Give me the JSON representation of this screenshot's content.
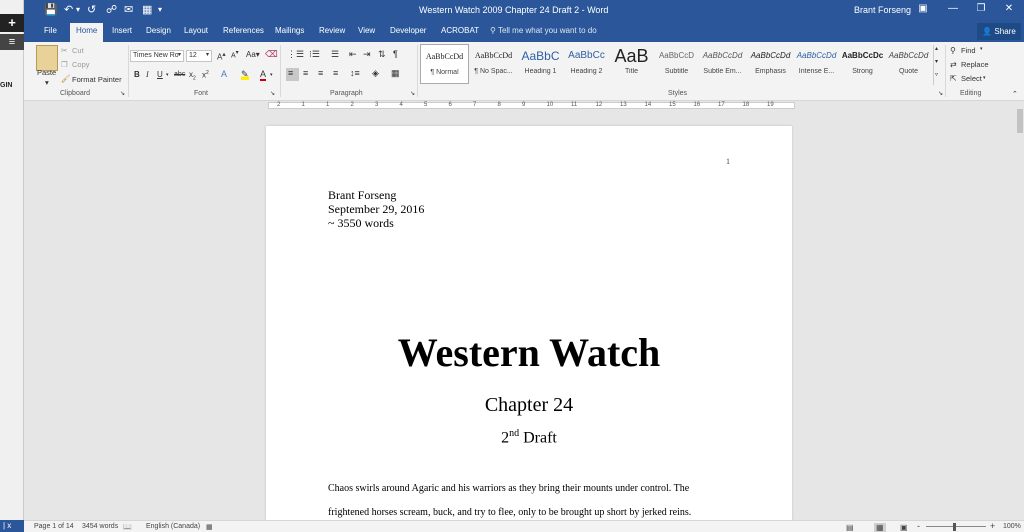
{
  "left_panel": {
    "plus": "+",
    "menu": "≡",
    "login_text": "GIN",
    "bottom_text": "| x"
  },
  "window": {
    "title": "Western Watch 2009 Chapter 24 Draft 2 - Word",
    "user": "Brant Forseng",
    "icons": [
      "save-icon",
      "undo-icon",
      "redo-icon",
      "touch-mode-icon",
      "email-icon",
      "customize-qat-icon"
    ]
  },
  "tabs": [
    "File",
    "Home",
    "Insert",
    "Design",
    "Layout",
    "References",
    "Mailings",
    "Review",
    "View",
    "Developer",
    "ACROBAT"
  ],
  "active_tab": "Home",
  "tell_me": "Tell me what you want to do",
  "share": "Share",
  "ribbon": {
    "clipboard": {
      "paste": "Paste",
      "cut": "Cut",
      "copy": "Copy",
      "format_painter": "Format Painter",
      "label": "Clipboard"
    },
    "font": {
      "font_name": "Times New Ro",
      "font_size": "12",
      "label": "Font"
    },
    "paragraph": {
      "label": "Paragraph"
    },
    "styles": {
      "label": "Styles",
      "items": [
        {
          "preview": "AaBbCcDd",
          "name": "¶ Normal"
        },
        {
          "preview": "AaBbCcDd",
          "name": "¶ No Spac..."
        },
        {
          "preview": "AaBbC",
          "name": "Heading 1"
        },
        {
          "preview": "AaBbCc",
          "name": "Heading 2"
        },
        {
          "preview": "AaB",
          "name": "Title"
        },
        {
          "preview": "AaBbCcD",
          "name": "Subtitle"
        },
        {
          "preview": "AaBbCcDd",
          "name": "Subtle Em..."
        },
        {
          "preview": "AaBbCcDd",
          "name": "Emphasis"
        },
        {
          "preview": "AaBbCcDd",
          "name": "Intense E..."
        },
        {
          "preview": "AaBbCcDc",
          "name": "Strong"
        },
        {
          "preview": "AaBbCcDd",
          "name": "Quote"
        }
      ]
    },
    "editing": {
      "find": "Find",
      "replace": "Replace",
      "select": "Select",
      "label": "Editing"
    }
  },
  "ruler_marks": [
    "2",
    "1",
    "1",
    "2",
    "3",
    "4",
    "5",
    "6",
    "7",
    "8",
    "9",
    "10",
    "11",
    "12",
    "13",
    "14",
    "15",
    "16",
    "17",
    "18",
    "19"
  ],
  "document": {
    "page_number": "1",
    "author": "Brant Forseng",
    "date": "September 29, 2016",
    "word_count": "~ 3550 words",
    "title": "Western Watch",
    "chapter": "Chapter 24",
    "draft_num": "2",
    "draft_sup": "nd",
    "draft_word": "Draft",
    "body_line1": "Chaos swirls around Agaric and his warriors as they bring their mounts under control.  The",
    "body_line2": "frightened horses scream, buck, and try to flee, only to be brought up short by jerked reins."
  },
  "status": {
    "page": "Page 1 of 14",
    "words": "3454 words",
    "language": "English (Canada)",
    "zoom": "100%",
    "minus": "-",
    "plus": "+"
  }
}
